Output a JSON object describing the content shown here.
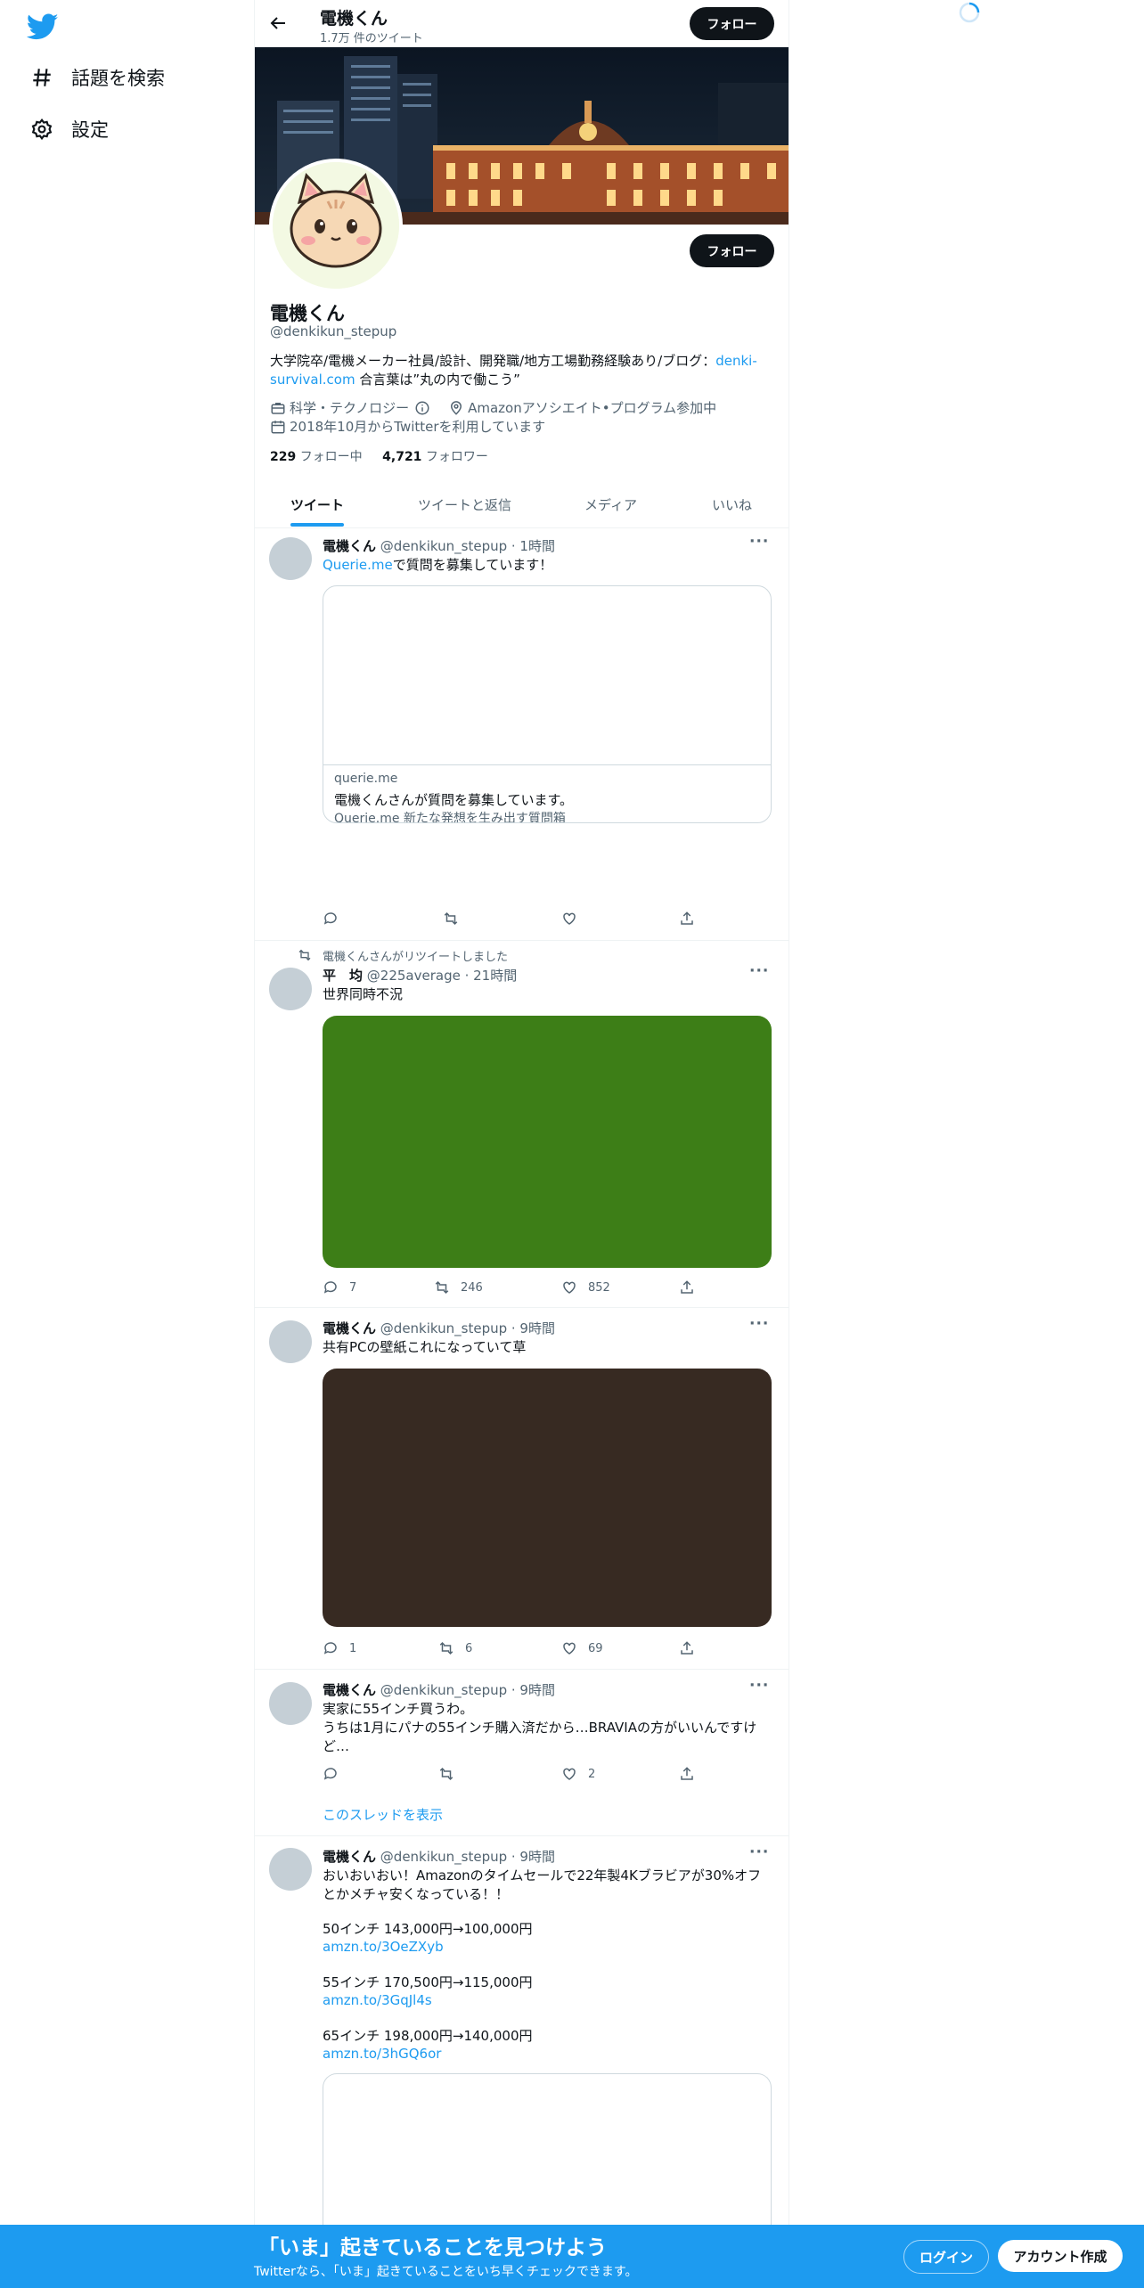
{
  "sidebar": {
    "items": [
      {
        "label": "話題を検索",
        "icon": "hashtag-icon"
      },
      {
        "label": "設定",
        "icon": "gear-icon"
      }
    ]
  },
  "topbar": {
    "name": "電機くん",
    "tweet_count": "1.7万 件のツイート",
    "follow_label": "フォロー"
  },
  "profile": {
    "follow_label": "フォロー",
    "name": "電機くん",
    "handle": "@denkikun_stepup",
    "bio_pre": "大学院卒/電機メーカー社員/設計、開発職/地方工場勤務経験あり/ブログ：",
    "bio_link": "denki-survival.com",
    "bio_post": " 合言葉は”丸の内で働こう”",
    "category": "科学・テクノロジー",
    "location": "Amazonアソシエイト•プログラム参加中",
    "joined": "2018年10月からTwitterを利用しています",
    "following_count": "229",
    "following_label": "フォロー中",
    "followers_count": "4,721",
    "followers_label": "フォロワー"
  },
  "tabs": [
    "ツイート",
    "ツイートと返信",
    "メディア",
    "いいね"
  ],
  "tweets": [
    {
      "name": "電機くん",
      "meta": "@denkikun_stepup · 1時間",
      "text_link": "Querie.me",
      "text": "で質問を募集しています！",
      "card": {
        "domain": "querie.me",
        "title": "電機くんさんが質問を募集しています。",
        "desc": "Querie.me 新たな発想を生み出す質問箱"
      },
      "reply": "",
      "retweet": "",
      "like": ""
    },
    {
      "retweeted_by": "電機くんさんがリツイートしました",
      "name": "平　均",
      "meta": "@225average · 21時間",
      "text": "世界同時不況",
      "media_color": "#3d7e17",
      "reply": "7",
      "retweet": "246",
      "like": "852"
    },
    {
      "name": "電機くん",
      "meta": "@denkikun_stepup · 9時間",
      "text": "共有PCの壁紙これになっていて草",
      "media_color": "#372a22",
      "reply": "1",
      "retweet": "6",
      "like": "69"
    },
    {
      "name": "電機くん",
      "meta": "@denkikun_stepup · 9時間",
      "text": "実家に55インチ買うわ。\nうちは1月にパナの55インチ購入済だから…BRAVIAの方がいいんですけど…",
      "reply": "",
      "retweet": "",
      "like": "2",
      "thread_label": "このスレッドを表示"
    },
    {
      "name": "電機くん",
      "meta": "@denkikun_stepup · 9時間",
      "text": "おいおいおい！Amazonのタイムセールで22年製4Kブラビアが30%オフとかメチャ安くなっている！！",
      "line1": "50インチ 143,000円→100,000円",
      "link1": "amzn.to/3OeZXyb",
      "line2": "55インチ 170,500円→115,000円",
      "link2": "amzn.to/3GqJl4s",
      "line3": "65インチ 198,000円→140,000円",
      "link3": "amzn.to/3hGQ6or"
    }
  ],
  "bottom_bar": {
    "title": "「いま」起きていることを見つけよう",
    "subtitle": "Twitterなら、「いま」起きていることをいち早くチェックできます。",
    "login_label": "ログイン",
    "signup_label": "アカウント作成"
  },
  "colors": {
    "accent": "#1d9bf0",
    "dark": "#0f1419",
    "muted": "#536471"
  }
}
